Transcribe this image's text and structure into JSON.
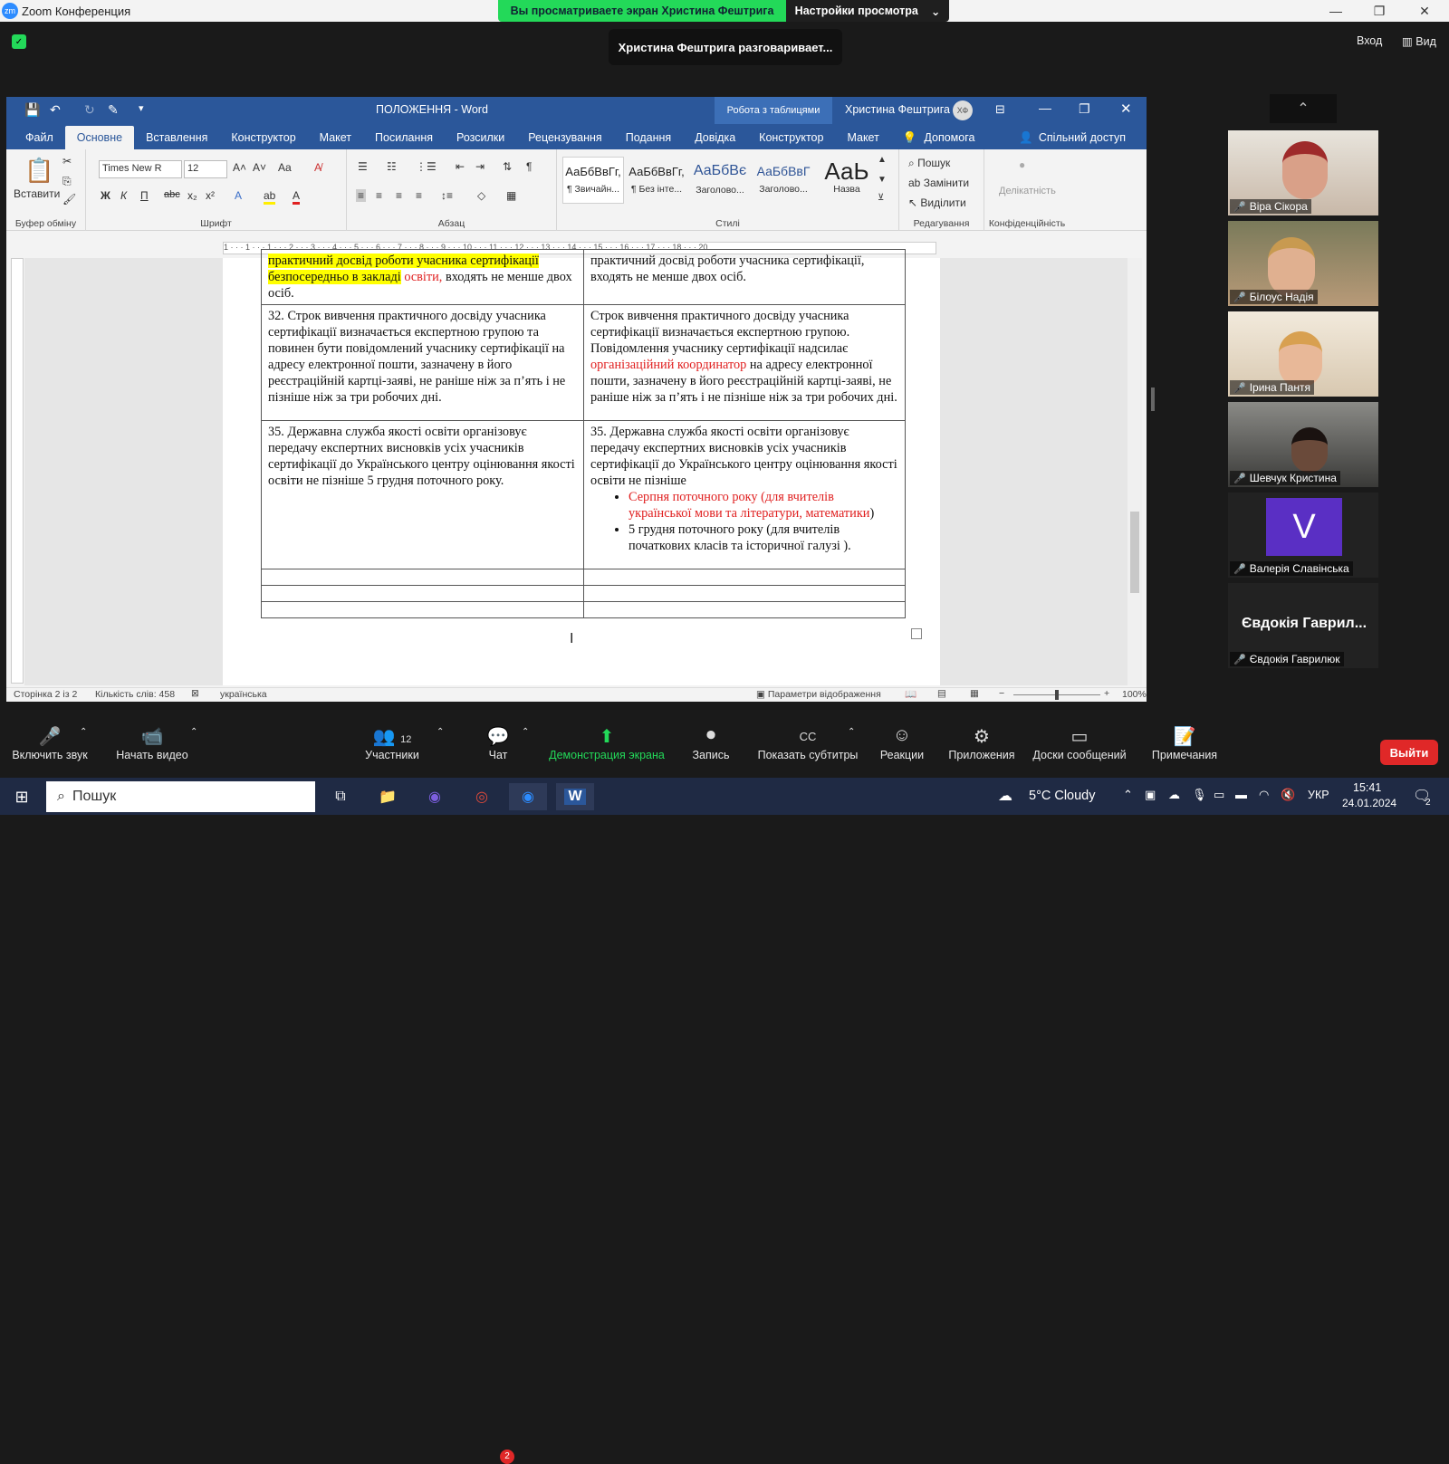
{
  "zoom": {
    "app_title": "Zoom Конференция",
    "share_notice": "Вы просматриваете экран Христина Фештрига",
    "view_options": "Настройки просмотра",
    "talking": "Христина Фештрига разговаривает...",
    "enter": "Вход",
    "view": "Вид"
  },
  "word": {
    "title": "ПОЛОЖЕННЯ  -  Word",
    "table_tools": "Робота з таблицями",
    "user": "Христина Фештрига",
    "user_initials": "ХФ",
    "tabs": [
      "Файл",
      "Основне",
      "Вставлення",
      "Конструктор",
      "Макет",
      "Посилання",
      "Розсилки",
      "Рецензування",
      "Подання",
      "Довідка",
      "Конструктор",
      "Макет"
    ],
    "help": "Допомога",
    "share": "Спільний доступ",
    "ribbon": {
      "paste": "Вставити",
      "clipboard": "Буфер обміну",
      "font_name": "Times New R",
      "font_size": "12",
      "font_group": "Шрифт",
      "paragraph_group": "Абзац",
      "styles_group": "Стилі",
      "editing_group": "Редагування",
      "sensitivity_group": "Конфіденційність",
      "sensitivity": "Делікатність",
      "find": "Пошук",
      "replace": "Замінити",
      "select": "Виділити",
      "styles": [
        {
          "sample": "АаБбВвГг,",
          "name": "¶ Звичайн..."
        },
        {
          "sample": "АаБбВвГг,",
          "name": "¶ Без інте..."
        },
        {
          "sample": "АаБбВє",
          "name": "Заголово..."
        },
        {
          "sample": "АаБбВвГ",
          "name": "Заголово..."
        },
        {
          "sample": "АаЬ",
          "name": "Назва"
        }
      ]
    },
    "ruler": "1 · · · 1 · · · 1 · · · 2 · · · 3 · · · 4 · · · 5 · · · 6 · · · 7 · · · 8 · · · 9 · · · 10 · · · 11 · · · 12 · · · 13 · · · 14 · · · 15 · · · 16 · · · 17 · · · 18 · · · 20",
    "doc": {
      "r1l_a": "практичний досвід роботи учасника сертифікації",
      "r1l_b": "безпосередньо в закладі",
      "r1l_c": " освіти,",
      "r1l_d": " входять не менше двох осіб.",
      "r1r": "практичний досвід роботи учасника сертифікації, входять не менше двох осіб.",
      "r2l": "32. Строк вивчення практичного досвіду учасника сертифікації визначається експертною групою та повинен бути повідомлений учаснику сертифікації на адресу електронної пошти, зазначену в його реєстраційній картці-заяві, не раніше ніж за п’ять і не пізніше ніж за три робочих дні.",
      "r2r_a": " Строк вивчення практичного досвіду учасника сертифікації визначається експертною групою. Повідомлення учаснику сертифікації надсилає ",
      "r2r_b": "організаційний координатор",
      "r2r_c": " на адресу електронної пошти, зазначену в його реєстраційній картці-заяві, не раніше ніж за п’ять і не пізніше ніж за три робочих дні.",
      "r3l": "35. Державна служба якості освіти організовує передачу експертних висновків усіх учасників сертифікації до Українського центру оцінювання якості освіти не пізніше 5 грудня поточного року.",
      "r3r": "35. Державна служба якості освіти організовує передачу експертних висновків усіх учасників сертифікації до Українського центру оцінювання якості освіти не пізніше",
      "bullet1": "Серпня поточного року (для вчителів української мови та літератури, математики",
      "bullet1_end": ")",
      "bullet2": "5 грудня поточного року (для вчителів початкових класів та історичної галузі )."
    },
    "status": {
      "page": "Сторінка 2 із 2",
      "words": "Кількість слів: 458",
      "lang": "українська",
      "display": "Параметри відображення",
      "zoom": "100%"
    }
  },
  "participants": [
    {
      "name": "Віра Сікора",
      "color": "#9a7a6a"
    },
    {
      "name": "Білоус Надія",
      "color": "#a8896e"
    },
    {
      "name": "Ірина Пантя",
      "color": "#b8a88e"
    },
    {
      "name": "Шевчук Кристина",
      "color": "#4a4a4a"
    },
    {
      "name": "Валерія Славінська",
      "initial": "V",
      "color": "#5a2fc4"
    },
    {
      "name": "Євдокія Гаврилюк",
      "big": "Євдокія Гаврил..."
    }
  ],
  "toolbar": [
    {
      "label": "Включить звук",
      "icon": "🎤"
    },
    {
      "label": "Начать видео",
      "icon": "📹"
    },
    {
      "label": "Участники",
      "icon": "👥",
      "count": "12"
    },
    {
      "label": "Чат",
      "icon": "💬",
      "badge": "2"
    },
    {
      "label": "Демонстрация экрана",
      "icon": "⬆"
    },
    {
      "label": "Запись",
      "icon": "⏺"
    },
    {
      "label": "Показать субтитры",
      "icon": "CC"
    },
    {
      "label": "Реакции",
      "icon": "☺"
    },
    {
      "label": "Приложения",
      "icon": "⚙"
    },
    {
      "label": "Доски сообщений",
      "icon": "▭"
    },
    {
      "label": "Примечания",
      "icon": "📝"
    }
  ],
  "leave": "Выйти",
  "taskbar": {
    "search": "Пошук",
    "weather": "5°C  Cloudy",
    "lang": "УКР",
    "time": "15:41",
    "date": "24.01.2024",
    "notif": "2"
  },
  "colors": {
    "word_blue": "#2b579a",
    "zoom_green": "#23d959",
    "leave_red": "#e02828"
  }
}
